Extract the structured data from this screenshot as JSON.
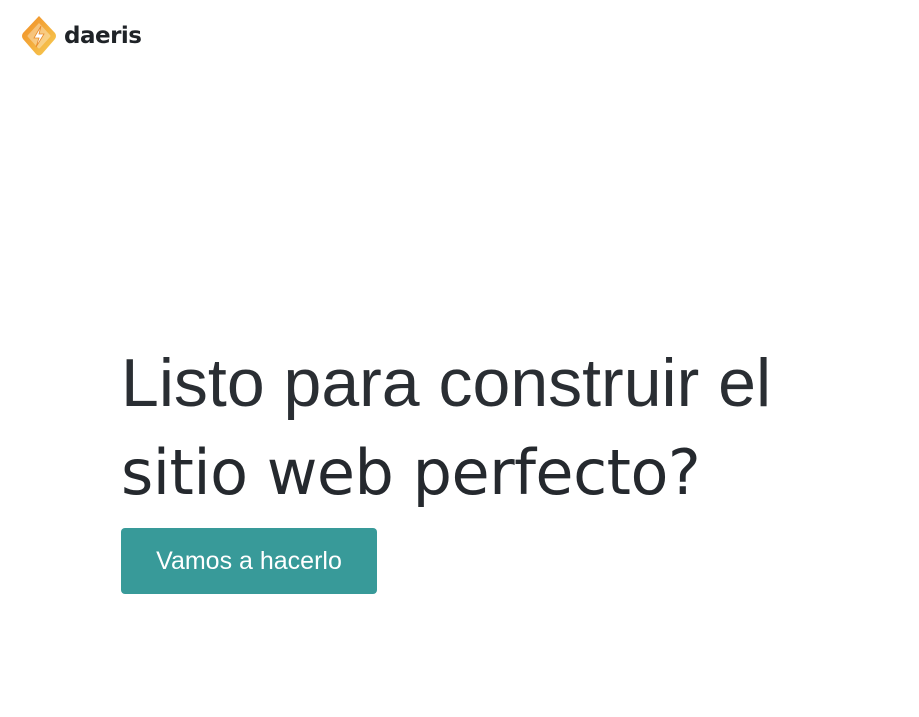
{
  "brand": {
    "name": "daeris",
    "logo_icon": "diamond-lightning-logo",
    "colors": {
      "gradient_start": "#f29b30",
      "gradient_end": "#f6c84a"
    }
  },
  "hero": {
    "title_line1": "Listo para construir el",
    "title_line2": "sitio web perfecto?",
    "cta_label": "Vamos a hacerlo"
  },
  "colors": {
    "cta_background": "#389a99",
    "text": "#25292e",
    "background": "#ffffff"
  }
}
